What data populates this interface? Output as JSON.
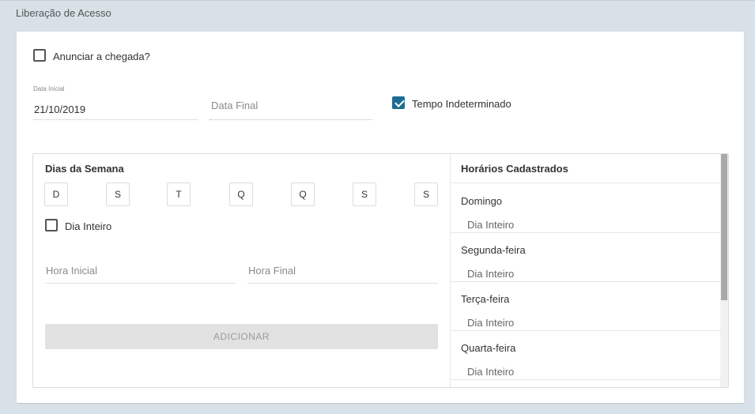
{
  "section": {
    "title": "Liberação de Acesso"
  },
  "form": {
    "announce": {
      "label": "Anunciar a chegada?",
      "checked": false
    },
    "start_date": {
      "label": "Data Inicial",
      "value": "21/10/2019"
    },
    "end_date": {
      "placeholder": "Data Final"
    },
    "indefinite": {
      "label": "Tempo Indeterminado",
      "checked": true
    }
  },
  "weekdays": {
    "title": "Dias da Semana",
    "days": [
      "D",
      "S",
      "T",
      "Q",
      "Q",
      "S",
      "S"
    ],
    "full_day": {
      "label": "Dia Inteiro",
      "checked": false
    },
    "start_time": {
      "placeholder": "Hora Inicial"
    },
    "end_time": {
      "placeholder": "Hora Final"
    },
    "add_button": "ADICIONAR"
  },
  "schedules": {
    "title": "Horários Cadastrados",
    "items": [
      {
        "day": "Domingo",
        "detail": "Dia Inteiro"
      },
      {
        "day": "Segunda-feira",
        "detail": "Dia Inteiro"
      },
      {
        "day": "Terça-feira",
        "detail": "Dia Inteiro"
      },
      {
        "day": "Quarta-feira",
        "detail": "Dia Inteiro"
      }
    ]
  },
  "colors": {
    "accent": "#1f6c93",
    "background": "#d7e1e7",
    "button_disabled": "#e2e2e2"
  }
}
